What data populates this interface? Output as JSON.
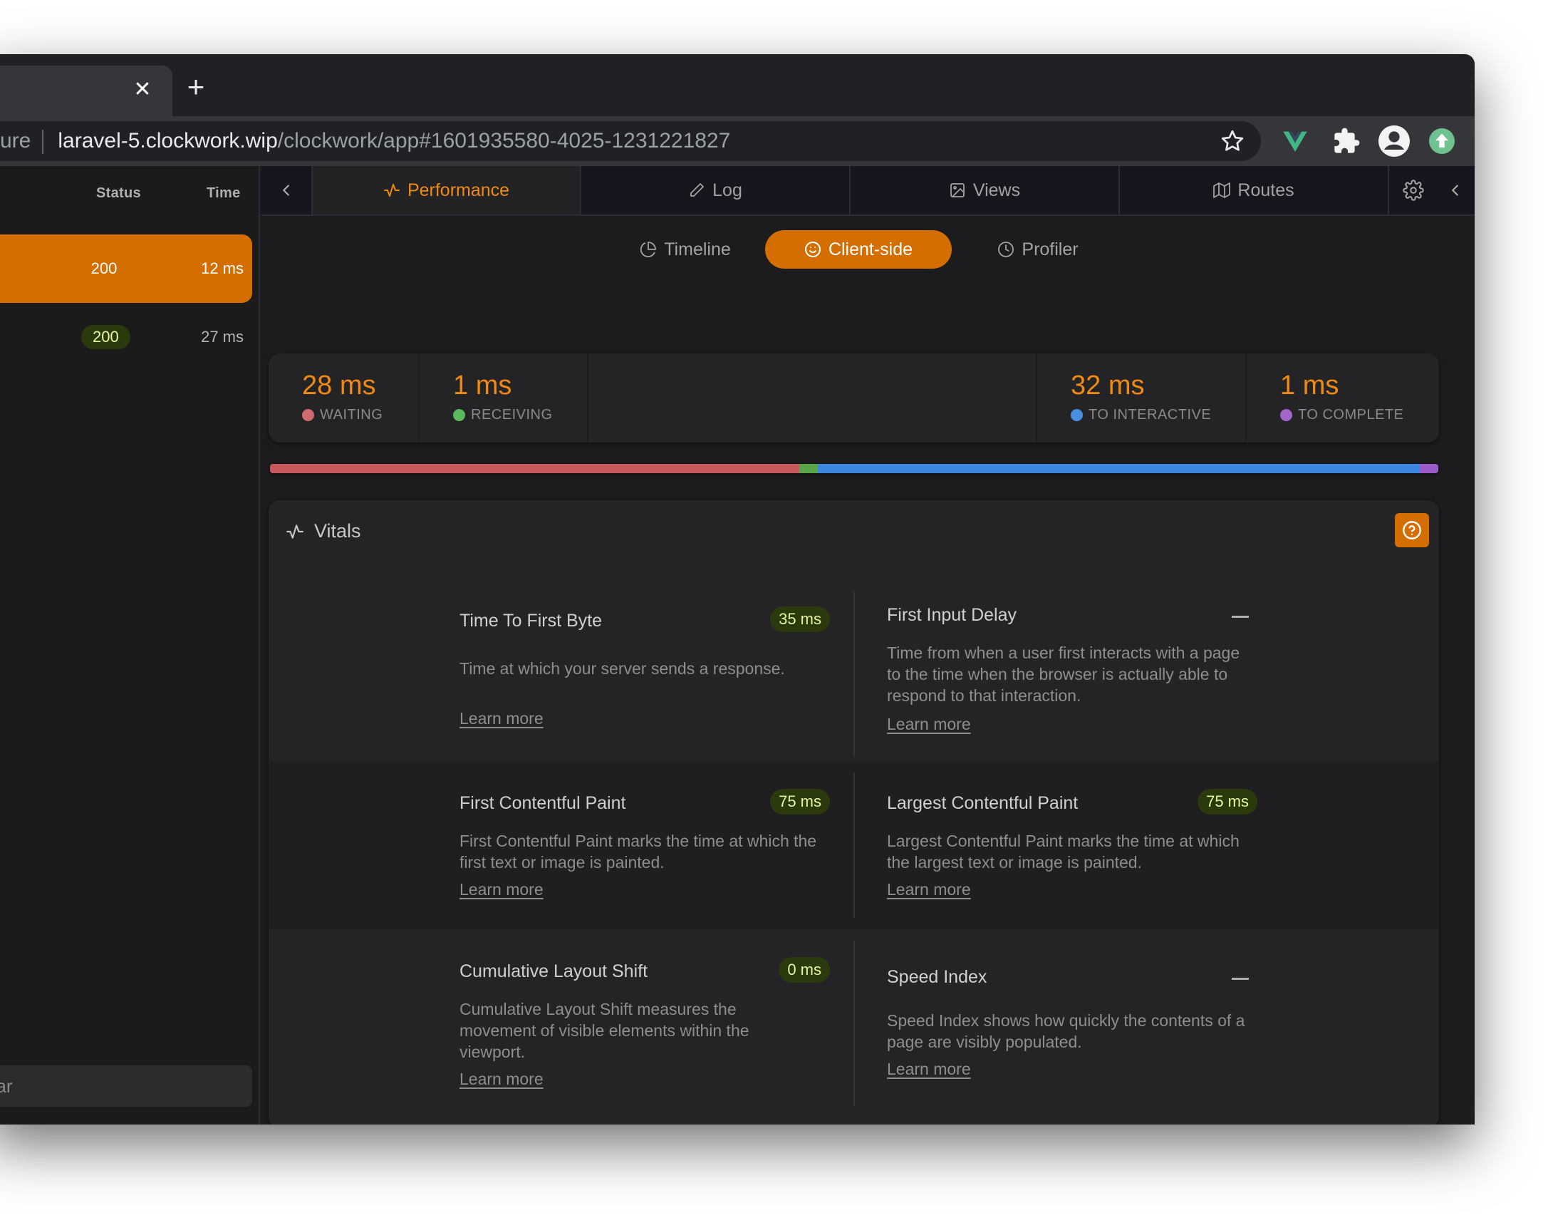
{
  "browser": {
    "tab_close": "✕",
    "new_tab": "+",
    "url_prefix": "ure",
    "url_host": "laravel-5.clockwork.wip",
    "url_path": "/clockwork/app#1601935580-4025-1231221827"
  },
  "sidebar": {
    "columns": {
      "status": "Status",
      "time": "Time"
    },
    "requests": [
      {
        "status": "200",
        "time": "12 ms",
        "selected": true
      },
      {
        "status": "200",
        "time": "27 ms",
        "selected": false
      }
    ],
    "search_placeholder": "ear"
  },
  "navbar": {
    "tabs": [
      {
        "label": "Performance",
        "icon": "activity-icon",
        "active": true
      },
      {
        "label": "Log",
        "icon": "pencil-icon",
        "active": false
      },
      {
        "label": "Views",
        "icon": "image-icon",
        "active": false
      },
      {
        "label": "Routes",
        "icon": "map-icon",
        "active": false
      }
    ]
  },
  "subtabs": [
    {
      "label": "Timeline",
      "icon": "pie-chart-icon",
      "active": false
    },
    {
      "label": "Client-side",
      "icon": "smile-icon",
      "active": true
    },
    {
      "label": "Profiler",
      "icon": "clock-icon",
      "active": false
    }
  ],
  "metrics": [
    {
      "value": "28 ms",
      "label": "WAITING",
      "color": "#cf6b6f"
    },
    {
      "value": "1 ms",
      "label": "RECEIVING",
      "color": "#5cb85c"
    },
    {
      "value": "32 ms",
      "label": "TO INTERACTIVE",
      "color": "#4a90e2"
    },
    {
      "value": "1 ms",
      "label": "TO COMPLETE",
      "color": "#a066c8"
    }
  ],
  "timeline_segments": [
    {
      "name": "waiting",
      "fraction": 0.453,
      "color": "#c85a5e"
    },
    {
      "name": "receiving",
      "fraction": 0.016,
      "color": "#5aa54a"
    },
    {
      "name": "to-interactive",
      "fraction": 0.515,
      "color": "#3a86e0"
    },
    {
      "name": "to-complete",
      "fraction": 0.016,
      "color": "#9b5ac8"
    }
  ],
  "vitals": {
    "title": "Vitals",
    "learn_more": "Learn more",
    "items": [
      {
        "title": "Time To First Byte",
        "value": "35 ms",
        "desc": "Time at which your server sends a response."
      },
      {
        "title": "First Input Delay",
        "value": null,
        "desc": "Time from when a user first interacts with a page to the time when the browser is actually able to respond to that interaction."
      },
      {
        "title": "First Contentful Paint",
        "value": "75 ms",
        "desc": "First Contentful Paint marks the time at which the first text or image is painted."
      },
      {
        "title": "Largest Contentful Paint",
        "value": "75 ms",
        "desc": "Largest Contentful Paint marks the time at which the largest text or image is painted."
      },
      {
        "title": "Cumulative Layout Shift",
        "value": "0 ms",
        "desc": "Cumulative Layout Shift measures the movement of visible elements within the viewport."
      },
      {
        "title": "Speed Index",
        "value": null,
        "desc": "Speed Index shows how quickly the contents of a page are visibly populated."
      }
    ]
  },
  "colors": {
    "accent": "#d46e00",
    "accent_text": "#f08a14",
    "badge_bg": "#2a3a0c",
    "badge_text": "#e4f7a0"
  }
}
